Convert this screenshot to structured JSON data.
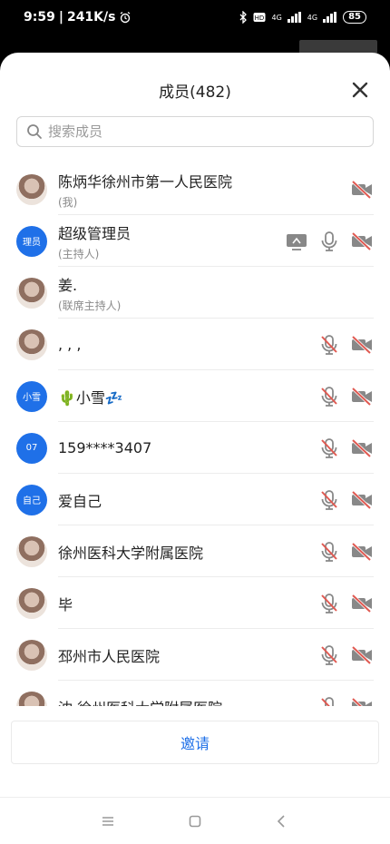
{
  "status_bar": {
    "time": "9:59",
    "speed": "241K/s",
    "network1": "4G",
    "network2": "4G",
    "battery": "85"
  },
  "header": {
    "title": "成员(482)"
  },
  "search": {
    "placeholder": "搜索成员"
  },
  "members": [
    {
      "name": "陈炳华徐州市第一人民医院",
      "role": "(我)",
      "avatar_type": "photo",
      "avatar_text": "",
      "screen_share": false,
      "mic": "none",
      "video": "off"
    },
    {
      "name": "超级管理员",
      "role": "(主持人)",
      "avatar_type": "initials",
      "avatar_text": "理员",
      "screen_share": true,
      "mic": "on",
      "video": "off"
    },
    {
      "name": "姜.",
      "role": "(联席主持人)",
      "avatar_type": "photo",
      "avatar_text": "",
      "screen_share": false,
      "mic": "none",
      "video": "none"
    },
    {
      "name": ", , ,",
      "role": "",
      "avatar_type": "photo",
      "avatar_text": "",
      "screen_share": false,
      "mic": "off",
      "video": "off"
    },
    {
      "name": "🌵小雪💤",
      "role": "",
      "avatar_type": "initials",
      "avatar_text": "小雪",
      "screen_share": false,
      "mic": "off",
      "video": "off"
    },
    {
      "name": "159****3407",
      "role": "",
      "avatar_type": "initials",
      "avatar_text": "07",
      "screen_share": false,
      "mic": "off",
      "video": "off"
    },
    {
      "name": "爱自己",
      "role": "",
      "avatar_type": "initials",
      "avatar_text": "自己",
      "screen_share": false,
      "mic": "off",
      "video": "off"
    },
    {
      "name": "徐州医科大学附属医院",
      "role": "",
      "avatar_type": "photo",
      "avatar_text": "",
      "screen_share": false,
      "mic": "off",
      "video": "off"
    },
    {
      "name": "毕",
      "role": "",
      "avatar_type": "photo",
      "avatar_text": "",
      "screen_share": false,
      "mic": "off",
      "video": "off"
    },
    {
      "name": "邳州市人民医院",
      "role": "",
      "avatar_type": "photo",
      "avatar_text": "",
      "screen_share": false,
      "mic": "off",
      "video": "off"
    },
    {
      "name": "沈 徐州医科大学附属医院",
      "role": "",
      "avatar_type": "photo",
      "avatar_text": "",
      "screen_share": false,
      "mic": "off",
      "video": "off"
    }
  ],
  "footer": {
    "invite_label": "邀请"
  },
  "colors": {
    "accent": "#1f70e8",
    "muted_red": "#e05a52"
  }
}
